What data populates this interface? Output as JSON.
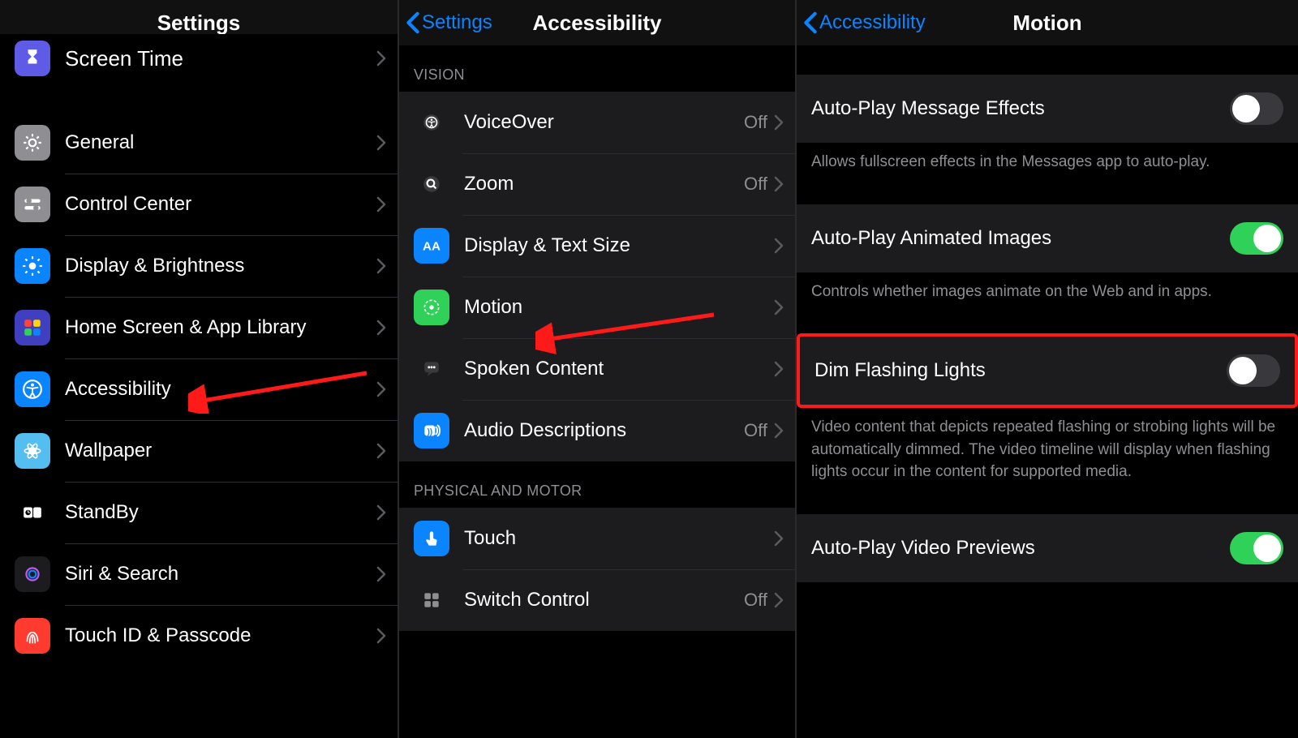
{
  "pane1": {
    "title": "Settings",
    "partial_item": {
      "label": "Screen Time",
      "icon_bg": "#5e5ce6"
    },
    "items": [
      {
        "label": "General",
        "icon_bg": "#8e8e93",
        "icon": "gear"
      },
      {
        "label": "Control Center",
        "icon_bg": "#8e8e93",
        "icon": "sliders"
      },
      {
        "label": "Display & Brightness",
        "icon_bg": "#0a84ff",
        "icon": "sun"
      },
      {
        "label": "Home Screen & App Library",
        "icon_bg": "#3f3fbf",
        "icon": "grid-color"
      },
      {
        "label": "Accessibility",
        "icon_bg": "#0a84ff",
        "icon": "accessibility"
      },
      {
        "label": "Wallpaper",
        "icon_bg": "#55bef0",
        "icon": "flower"
      },
      {
        "label": "StandBy",
        "icon_bg": "#000000",
        "icon": "standby"
      },
      {
        "label": "Siri & Search",
        "icon_bg": "#1c1c1e",
        "icon": "siri"
      },
      {
        "label": "Touch ID & Passcode",
        "icon_bg": "#ff3b30",
        "icon": "touchid"
      }
    ]
  },
  "pane2": {
    "back": "Settings",
    "title": "Accessibility",
    "group1_header": "VISION",
    "group1": [
      {
        "label": "VoiceOver",
        "detail": "Off",
        "icon_bg": "#1c1c1e",
        "icon": "voiceover"
      },
      {
        "label": "Zoom",
        "detail": "Off",
        "icon_bg": "#1c1c1e",
        "icon": "zoom"
      },
      {
        "label": "Display & Text Size",
        "detail": "",
        "icon_bg": "#0a84ff",
        "icon": "aa"
      },
      {
        "label": "Motion",
        "detail": "",
        "icon_bg": "#30d158",
        "icon": "motion"
      },
      {
        "label": "Spoken Content",
        "detail": "",
        "icon_bg": "#1c1c1e",
        "icon": "spoken"
      },
      {
        "label": "Audio Descriptions",
        "detail": "Off",
        "icon_bg": "#0a84ff",
        "icon": "audiodesc"
      }
    ],
    "group2_header": "PHYSICAL AND MOTOR",
    "group2": [
      {
        "label": "Touch",
        "detail": "",
        "icon_bg": "#0a84ff",
        "icon": "touch"
      },
      {
        "label": "Switch Control",
        "detail": "Off",
        "icon_bg": "#1c1c1e",
        "icon": "switchcontrol"
      }
    ]
  },
  "pane3": {
    "back": "Accessibility",
    "title": "Motion",
    "rows": [
      {
        "label": "Auto-Play Message Effects",
        "on": false,
        "footer": "Allows fullscreen effects in the Messages app to auto-play."
      },
      {
        "label": "Auto-Play Animated Images",
        "on": true,
        "footer": "Controls whether images animate on the Web and in apps."
      },
      {
        "label": "Dim Flashing Lights",
        "on": false,
        "footer": "Video content that depicts repeated flashing or strobing lights will be automatically dimmed. The video timeline will display when flashing lights occur in the content for supported media."
      },
      {
        "label": "Auto-Play Video Previews",
        "on": true,
        "footer": ""
      }
    ]
  }
}
